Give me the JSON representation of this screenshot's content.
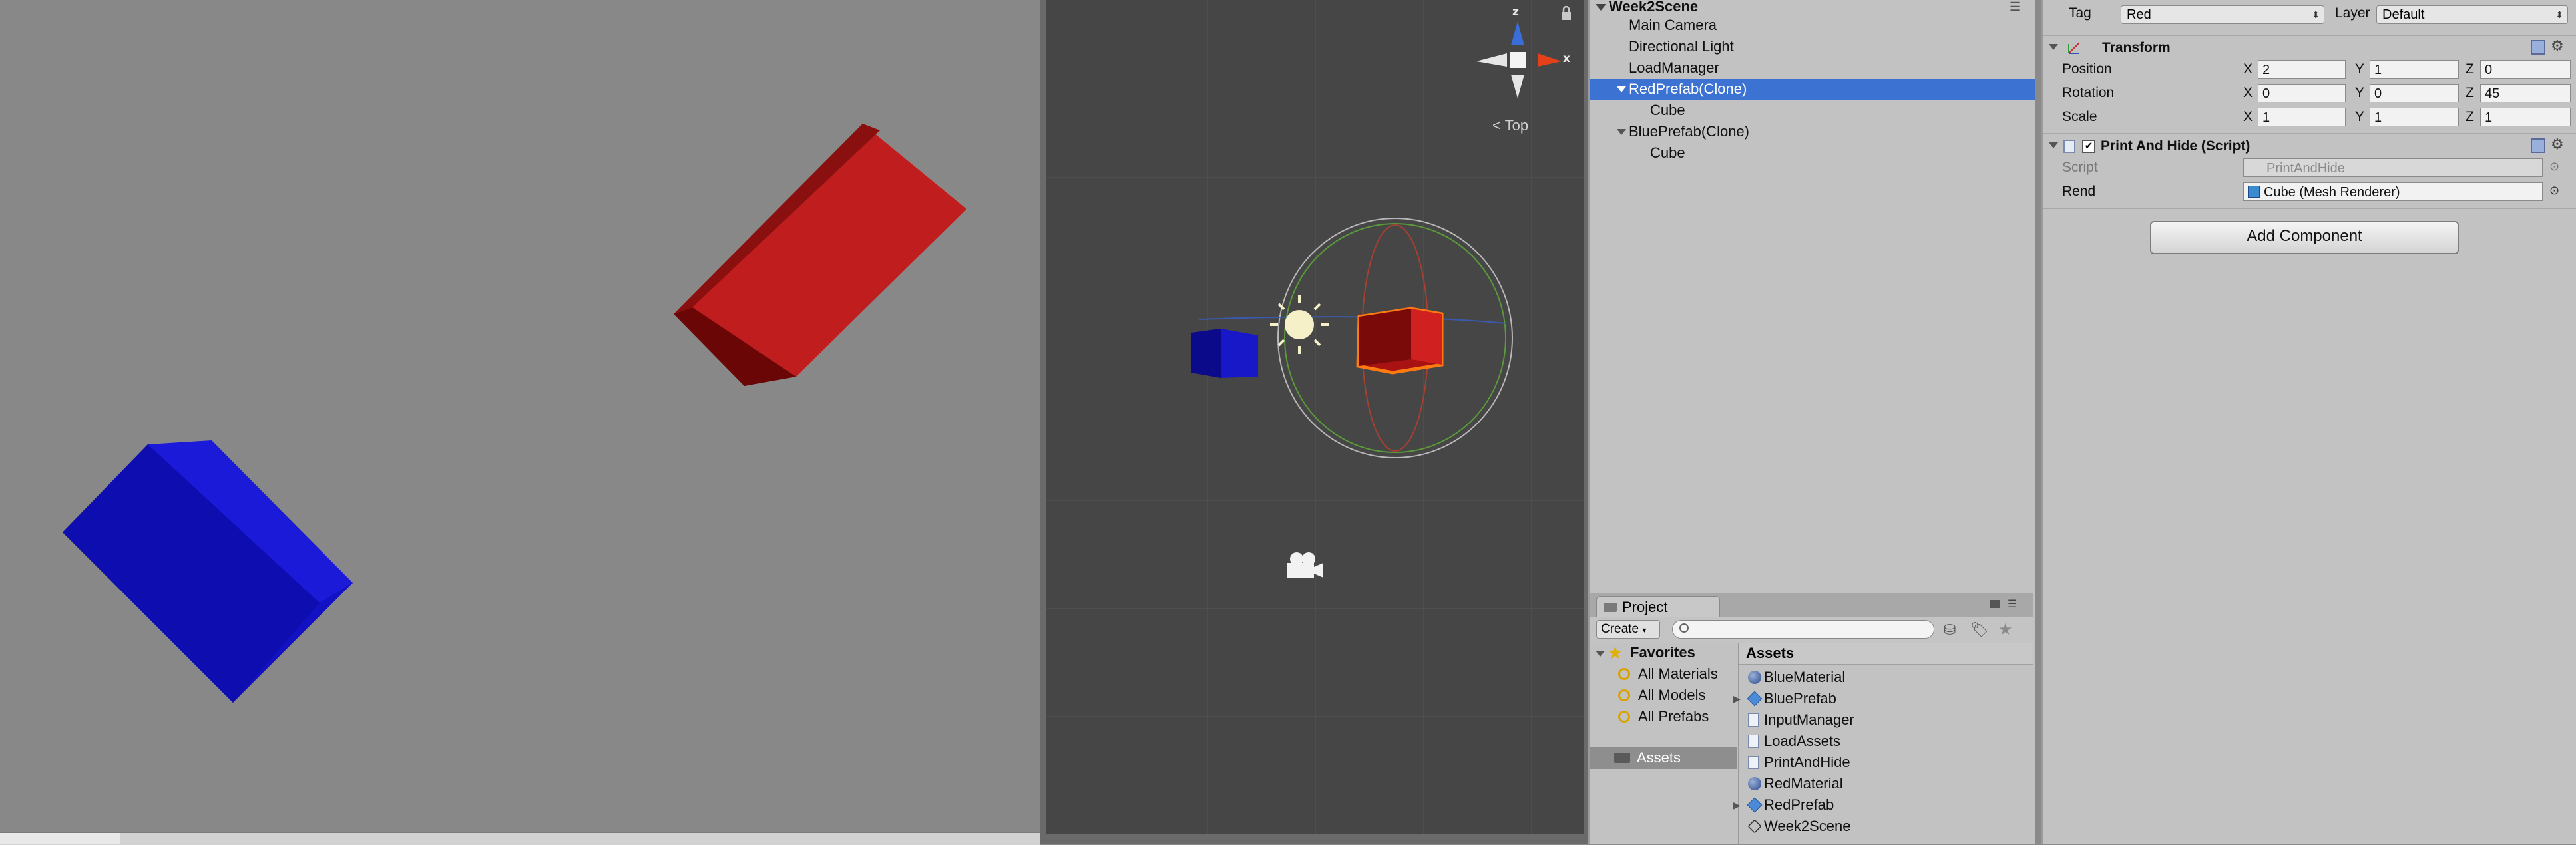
{
  "scene_gizmo": {
    "z": "z",
    "x": "x",
    "view": "Top",
    "view_arrow": "<"
  },
  "hierarchy": {
    "title": "Week2Scene",
    "items": [
      {
        "label": "Main Camera"
      },
      {
        "label": "Directional Light"
      },
      {
        "label": "LoadManager"
      },
      {
        "label": "RedPrefab(Clone)"
      },
      {
        "label": "Cube"
      },
      {
        "label": "BluePrefab(Clone)"
      },
      {
        "label": "Cube"
      }
    ]
  },
  "inspector": {
    "tag_label": "Tag",
    "tag_value": "Red",
    "layer_label": "Layer",
    "layer_value": "Default",
    "transform": {
      "title": "Transform",
      "position_label": "Position",
      "rotation_label": "Rotation",
      "scale_label": "Scale",
      "position": {
        "x": "2",
        "y": "1",
        "z": "0"
      },
      "rotation": {
        "x": "0",
        "y": "0",
        "z": "45"
      },
      "scale": {
        "x": "1",
        "y": "1",
        "z": "1"
      },
      "axis_x": "X",
      "axis_y": "Y",
      "axis_z": "Z"
    },
    "script_component": {
      "title": "Print And Hide (Script)",
      "script_label": "Script",
      "script_value": "PrintAndHide",
      "rend_label": "Rend",
      "rend_value": "Cube (Mesh Renderer)"
    },
    "add_component": "Add Component"
  },
  "project": {
    "tab": "Project",
    "create": "Create",
    "favorites_label": "Favorites",
    "favorites": [
      "All Materials",
      "All Models",
      "All Prefabs"
    ],
    "assets_folder": "Assets",
    "assets_header": "Assets",
    "assets": [
      {
        "label": "BlueMaterial",
        "icon": "material-icon"
      },
      {
        "label": "BluePrefab",
        "icon": "prefab-icon"
      },
      {
        "label": "InputManager",
        "icon": "script-icon"
      },
      {
        "label": "LoadAssets",
        "icon": "script-icon"
      },
      {
        "label": "PrintAndHide",
        "icon": "script-icon"
      },
      {
        "label": "RedMaterial",
        "icon": "material-icon"
      },
      {
        "label": "RedPrefab",
        "icon": "prefab-icon"
      },
      {
        "label": "Week2Scene",
        "icon": "unity-scene-icon"
      }
    ]
  },
  "colors": {
    "red_cube": "#c01e1e",
    "blue_cube": "#1414c8",
    "selection": "#3c72d2"
  }
}
